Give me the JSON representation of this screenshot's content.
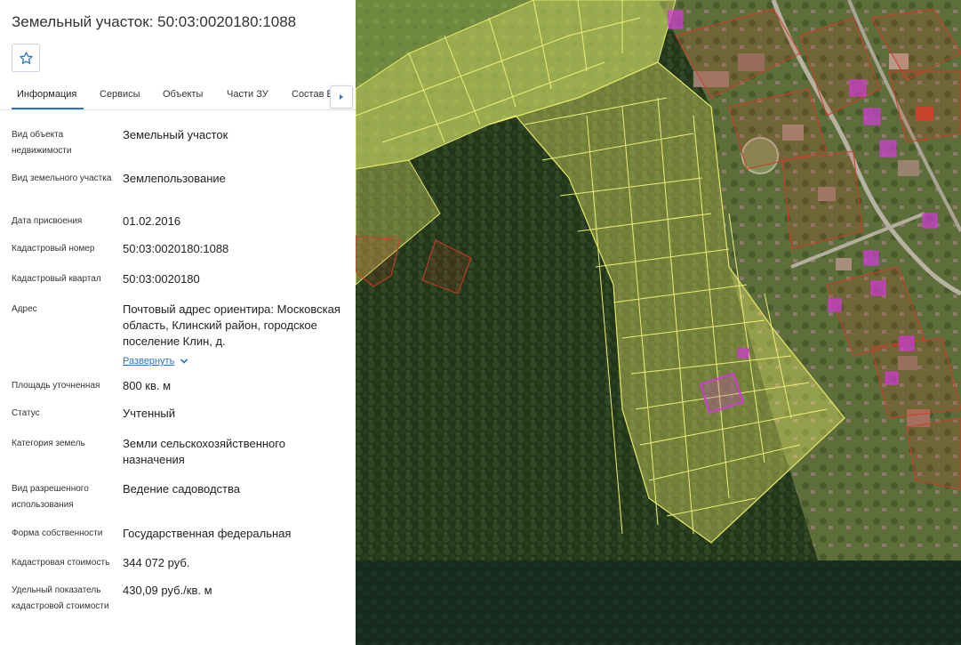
{
  "header": {
    "title": "Земельный участок: 50:03:0020180:1088"
  },
  "tabs": [
    {
      "label": "Информация",
      "active": true
    },
    {
      "label": "Сервисы",
      "active": false
    },
    {
      "label": "Объекты",
      "active": false
    },
    {
      "label": "Части ЗУ",
      "active": false
    },
    {
      "label": "Состав ЕЗП",
      "active": false
    }
  ],
  "details": {
    "object_type": {
      "label": "Вид объекта недвижимости",
      "value": "Земельный участок"
    },
    "plot_type": {
      "label": "Вид земельного участка",
      "value": "Землепользование"
    },
    "assign_date": {
      "label": "Дата присвоения",
      "value": "01.02.2016"
    },
    "cadastral_number": {
      "label": "Кадастровый номер",
      "value": "50:03:0020180:1088"
    },
    "cadastral_quarter": {
      "label": "Кадастровый квартал",
      "value": "50:03:0020180"
    },
    "address": {
      "label": "Адрес",
      "value": "Почтовый адрес ориентира: Московская область, Клинский район, городское поселение Клин, д.",
      "expand_label": "Развернуть"
    },
    "area": {
      "label": "Площадь уточненная",
      "value": "800 кв. м"
    },
    "status": {
      "label": "Статус",
      "value": "Учтенный"
    },
    "category": {
      "label": "Категория земель",
      "value": "Земли сельскохозяйственного назначения"
    },
    "permitted_use": {
      "label": "Вид разрешенного использования",
      "value": "Ведение садоводства"
    },
    "ownership": {
      "label": "Форма собственности",
      "value": "Государственная федеральная"
    },
    "cadastral_value": {
      "label": "Кадастровая стоимость",
      "value": "344 072 руб."
    },
    "specific_value": {
      "label": "Удельный показатель кадастровой стоимости",
      "value": "430,09 руб./кв. м"
    }
  },
  "icons": {
    "favorite": "star-outline-icon",
    "tabs_scroll": "caret-right-icon",
    "expand": "chevron-down-icon"
  },
  "colors": {
    "accent": "#2a73c6",
    "parcel_yellow": "#e8e86a",
    "parcel_red": "#d23b2a",
    "parcel_selected": "#d13ad6"
  }
}
